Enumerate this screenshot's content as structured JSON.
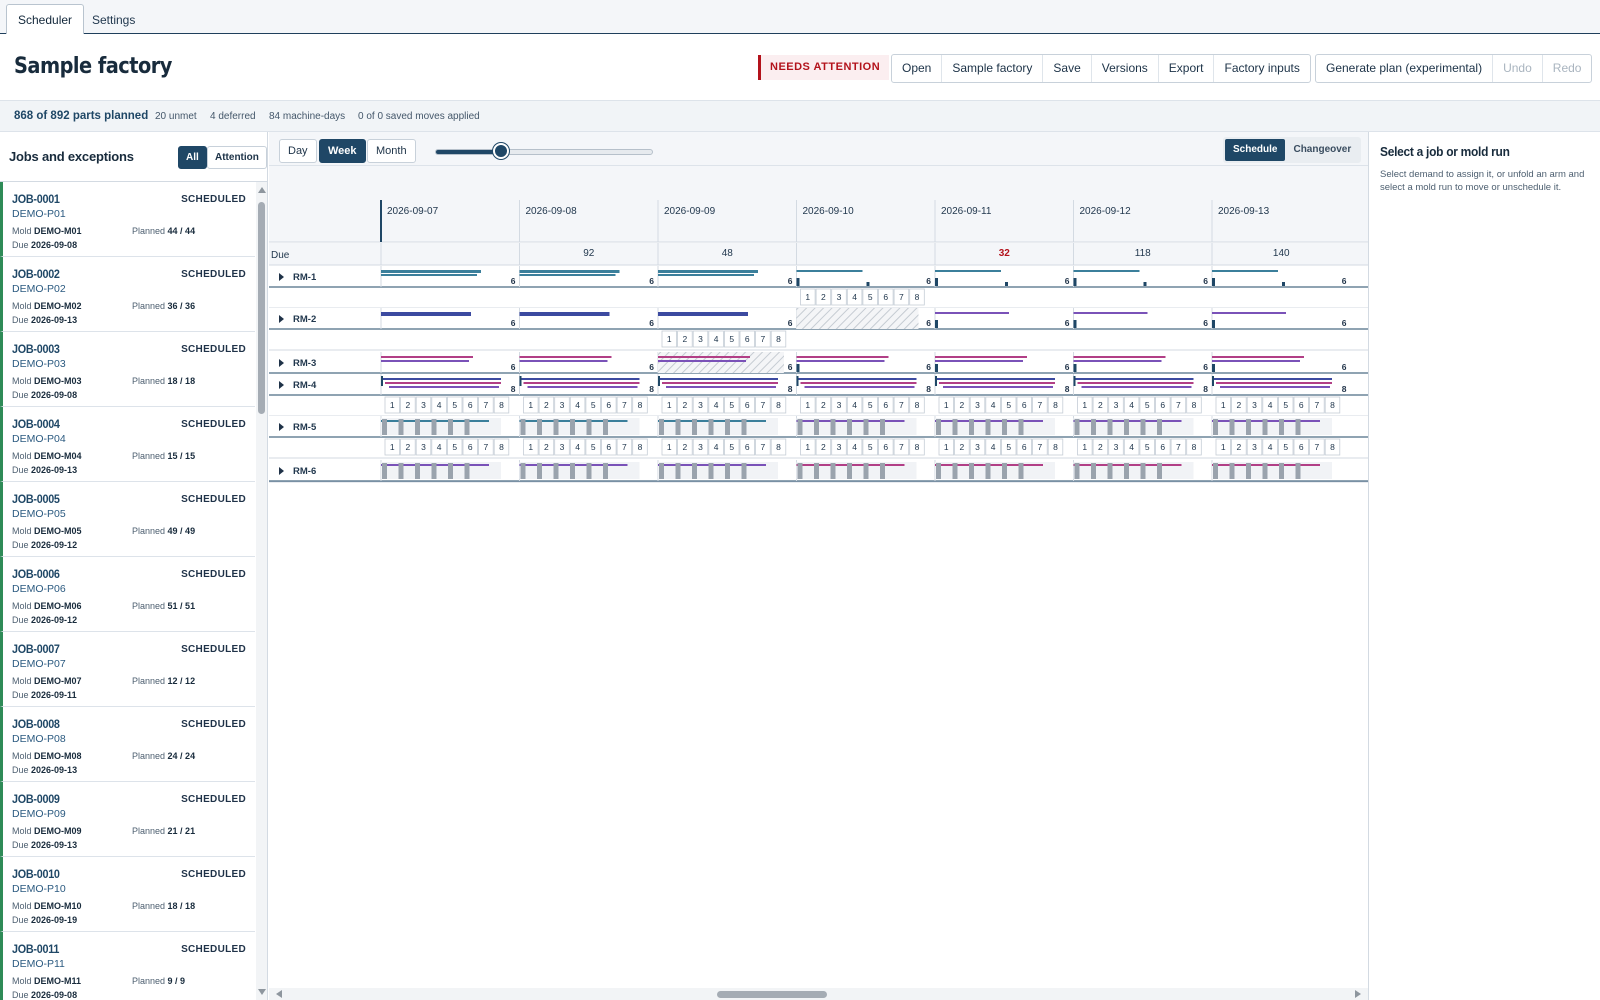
{
  "tabs": [
    {
      "label": "Scheduler",
      "active": true
    },
    {
      "label": "Settings",
      "active": false
    }
  ],
  "header": {
    "title": "Sample factory",
    "status_badge": "NEEDS ATTENTION",
    "file_buttons": [
      "Open",
      "Sample factory",
      "Save",
      "Versions",
      "Export",
      "Factory inputs"
    ],
    "plan_button": "Generate plan (experimental)",
    "undo": "Undo",
    "redo": "Redo"
  },
  "stats": {
    "planned": "868 of 892 parts planned",
    "unmet": "20 unmet",
    "deferred": "4 deferred",
    "machine_days": "84 machine-days",
    "saved_moves": "0 of 0 saved moves applied"
  },
  "jobs_panel": {
    "title": "Jobs and exceptions",
    "filter_all": "All",
    "filter_attention": "Attention",
    "mold_label": "Mold",
    "due_label": "Due",
    "planned_label": "Planned",
    "jobs": [
      {
        "id": "JOB-0001",
        "part": "DEMO-P01",
        "status": "SCHEDULED",
        "mold": "DEMO-M01",
        "due": "2026-09-08",
        "planned": "44 / 44"
      },
      {
        "id": "JOB-0002",
        "part": "DEMO-P02",
        "status": "SCHEDULED",
        "mold": "DEMO-M02",
        "due": "2026-09-13",
        "planned": "36 / 36"
      },
      {
        "id": "JOB-0003",
        "part": "DEMO-P03",
        "status": "SCHEDULED",
        "mold": "DEMO-M03",
        "due": "2026-09-08",
        "planned": "18 / 18"
      },
      {
        "id": "JOB-0004",
        "part": "DEMO-P04",
        "status": "SCHEDULED",
        "mold": "DEMO-M04",
        "due": "2026-09-13",
        "planned": "15 / 15"
      },
      {
        "id": "JOB-0005",
        "part": "DEMO-P05",
        "status": "SCHEDULED",
        "mold": "DEMO-M05",
        "due": "2026-09-12",
        "planned": "49 / 49"
      },
      {
        "id": "JOB-0006",
        "part": "DEMO-P06",
        "status": "SCHEDULED",
        "mold": "DEMO-M06",
        "due": "2026-09-12",
        "planned": "51 / 51"
      },
      {
        "id": "JOB-0007",
        "part": "DEMO-P07",
        "status": "SCHEDULED",
        "mold": "DEMO-M07",
        "due": "2026-09-11",
        "planned": "12 / 12"
      },
      {
        "id": "JOB-0008",
        "part": "DEMO-P08",
        "status": "SCHEDULED",
        "mold": "DEMO-M08",
        "due": "2026-09-13",
        "planned": "24 / 24"
      },
      {
        "id": "JOB-0009",
        "part": "DEMO-P09",
        "status": "SCHEDULED",
        "mold": "DEMO-M09",
        "due": "2026-09-13",
        "planned": "21 / 21"
      },
      {
        "id": "JOB-0010",
        "part": "DEMO-P10",
        "status": "SCHEDULED",
        "mold": "DEMO-M10",
        "due": "2026-09-19",
        "planned": "18 / 18"
      },
      {
        "id": "JOB-0011",
        "part": "DEMO-P11",
        "status": "SCHEDULED",
        "mold": "DEMO-M11",
        "due": "2026-09-08",
        "planned": "9 / 9"
      }
    ]
  },
  "timeline": {
    "view_buttons": [
      "Day",
      "Week",
      "Month"
    ],
    "active_view": "Week",
    "mode_buttons": [
      "Schedule",
      "Changeover"
    ],
    "active_mode": "Schedule",
    "due_label": "Due",
    "dates": [
      "2026-09-07",
      "2026-09-08",
      "2026-09-09",
      "2026-09-10",
      "2026-09-11",
      "2026-09-12",
      "2026-09-13"
    ],
    "due_values": [
      "",
      "92",
      "48",
      "",
      "32",
      "118",
      "140"
    ],
    "due_alert_day_index": 4,
    "machines": [
      "RM-1",
      "RM-2",
      "RM-3",
      "RM-4",
      "RM-5",
      "RM-6"
    ],
    "shift_labels": [
      "1",
      "2",
      "3",
      "4",
      "5",
      "6",
      "7",
      "8"
    ],
    "day_totals": {
      "RM-1": "6",
      "RM-2": "6",
      "RM-3": "6",
      "RM-4": "8"
    }
  },
  "details_panel": {
    "title": "Select a job or mold run",
    "body": "Select demand to assign it, or unfold an arm and select a mold run to move or unschedule it."
  },
  "colors": {
    "accent": "#1f4766",
    "attention": "#b3121b",
    "scheduled": "#2e8b57",
    "bar_teal": "#3b7f9b",
    "bar_navy": "#3c4aa0",
    "bar_purple": "#7a52b8",
    "bar_magenta": "#b23f86"
  }
}
